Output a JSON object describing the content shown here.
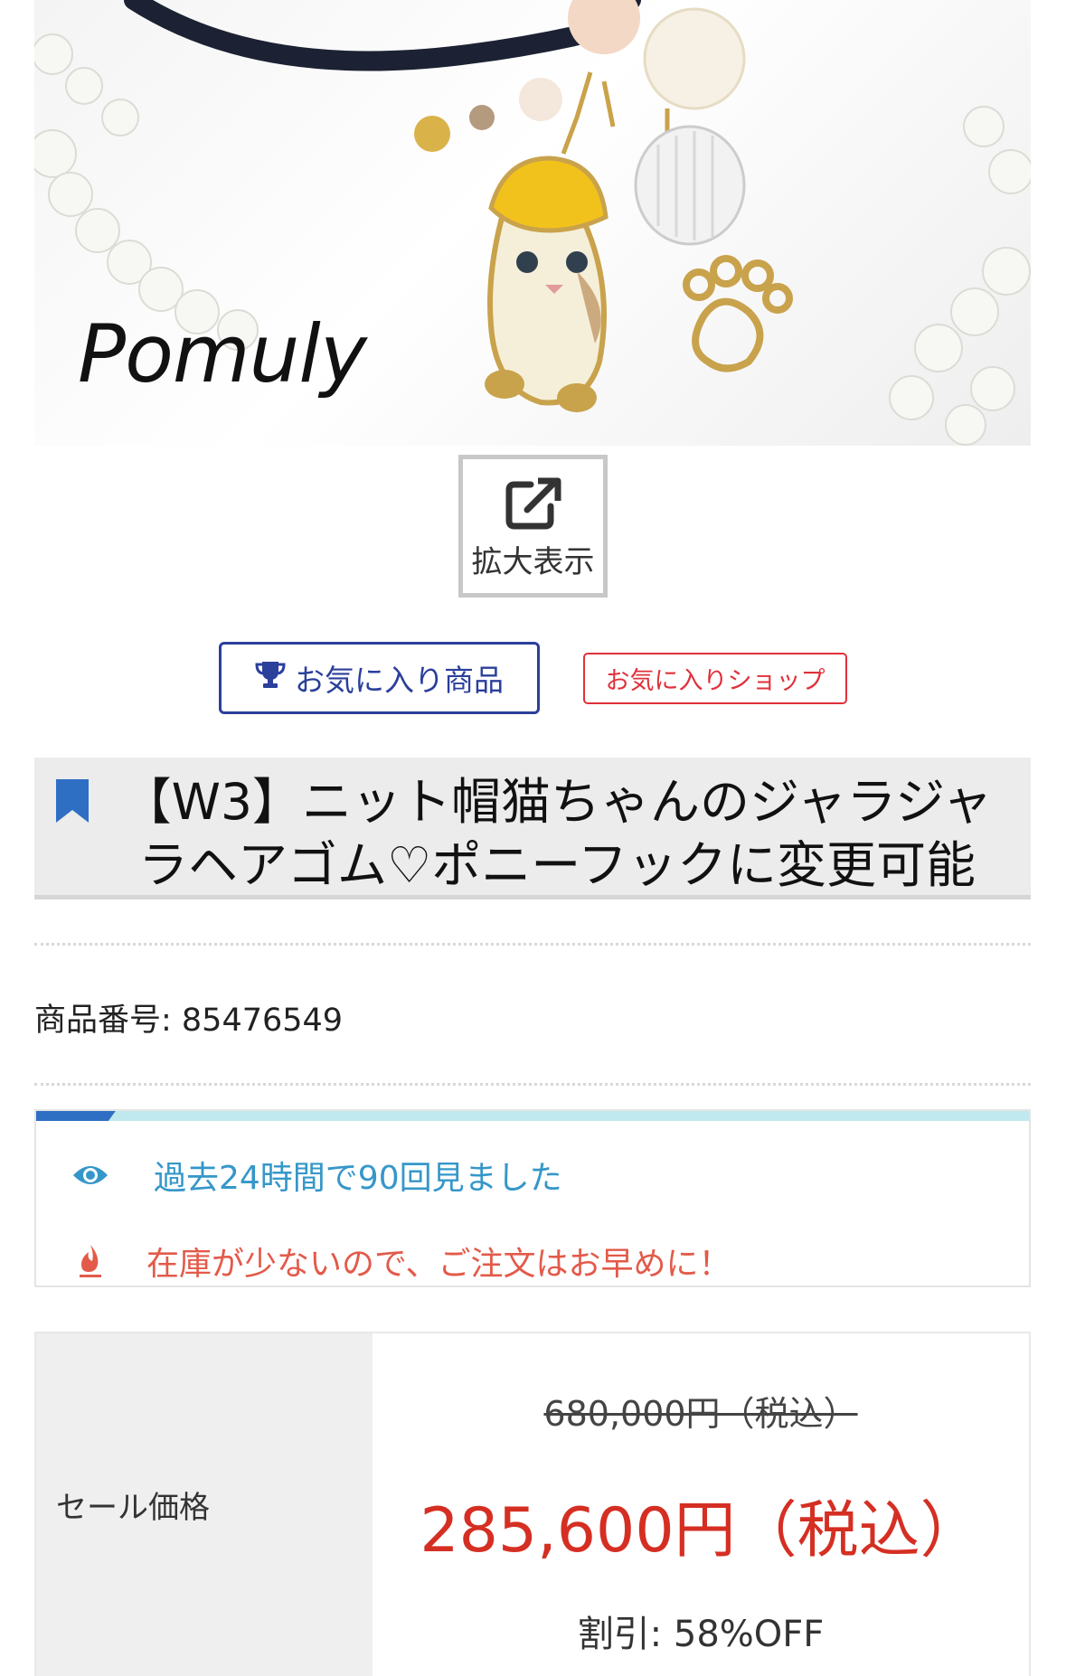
{
  "product_image": {
    "brand_watermark": "Pomuly"
  },
  "zoom_button": {
    "label": "拡大表示"
  },
  "favorites": {
    "item_label": "お気に入り商品",
    "shop_label": "お気に入りショップ"
  },
  "product": {
    "title": "【W3】ニット帽猫ちゃんのジャラジャラヘアゴム♡ポニーフックに変更可能",
    "number_label": "商品番号: 85476549"
  },
  "info": {
    "progress_fraction": 0.08,
    "views_text": "過去24時間で90回見ました",
    "stock_text": "在庫が少ないので、ご注文はお早めに！"
  },
  "price": {
    "label": "セール価格",
    "original": "680,000円（税込）",
    "sale": "285,600円（税込）",
    "discount": "割引:  58%OFF"
  },
  "colors": {
    "accent_blue": "#2b3f9b",
    "accent_red": "#e0303a",
    "sale_red": "#d52f23",
    "info_blue": "#3597c9",
    "info_red": "#e35a4a"
  }
}
